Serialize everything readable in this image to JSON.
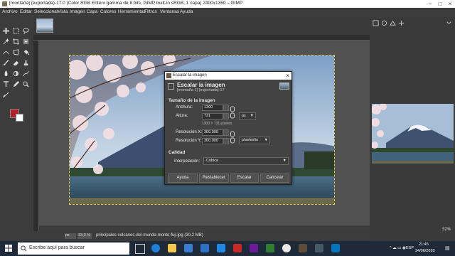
{
  "window": {
    "title": "[montaña] (exportada)-17.0 (Color RGB Entero gamma de 8 bits, GIMP built-in sRGB, 1 capa) 2400x1350 – GIMP"
  },
  "menubar": [
    "Archivo",
    "Editar",
    "Seleccionar",
    "Vista",
    "Imagen",
    "Capa",
    "Colores",
    "Herramientas",
    "Filtros",
    "Ventanas",
    "Ayuda"
  ],
  "dialog": {
    "title": "Escalar la imagen",
    "heading": "Escalar la imagen",
    "subheading": "[montaña 1] (exportada)-17",
    "section_size": "Tamaño de la imagen",
    "width_label": "Anchura:",
    "width_value": "1300",
    "height_label": "Altura:",
    "height_value": "731",
    "size_unit": "px",
    "pixels_info": "1300 × 731 píxeles",
    "resx_label": "Resolución X:",
    "resx_value": "300.000",
    "resy_label": "Resolución Y:",
    "resy_value": "300.000",
    "res_unit": "píxeles/in",
    "section_quality": "Calidad",
    "interp_label": "Interpolación:",
    "interp_value": "Cúbica",
    "btn_help": "Ayuda",
    "btn_reset": "Restablecer",
    "btn_scale": "Escalar",
    "btn_cancel": "Cancelar"
  },
  "status": {
    "unit": "px",
    "zoom": "33,3 %",
    "filename": "principales-volcanes-del-mundo-monte-fuji.jpg (30,2 MB)"
  },
  "dock": {
    "zoom": "32%"
  },
  "taskbar": {
    "search_placeholder": "Escribe aquí para buscar",
    "lang": "ESP",
    "time": "21:45",
    "date": "24/06/2020"
  },
  "colors": {
    "foreground": "#b21e28",
    "background": "#ffffff",
    "selection": "#e0c84a"
  }
}
